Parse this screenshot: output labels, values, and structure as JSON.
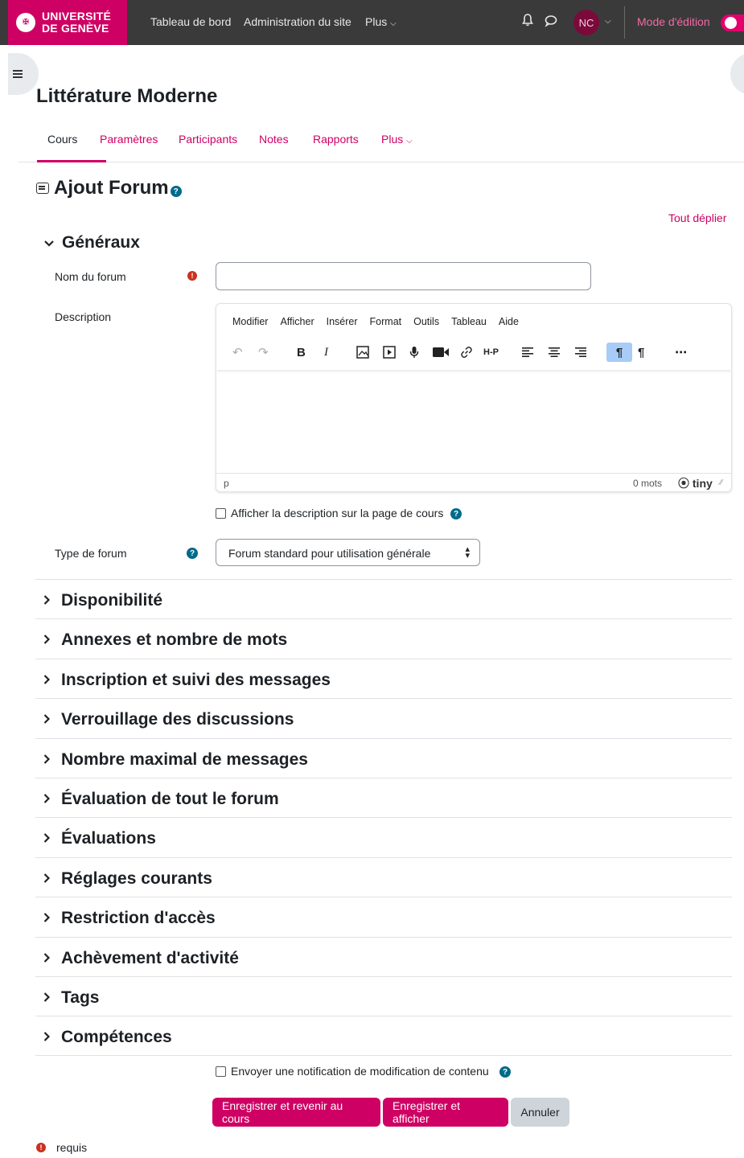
{
  "navbar": {
    "logo_line1": "UNIVERSITÉ",
    "logo_line2": "DE GENÈVE",
    "links": [
      "Tableau de bord",
      "Administration du site",
      "Plus"
    ],
    "avatar_initials": "NC",
    "edit_mode_label": "Mode d'édition"
  },
  "course": {
    "title": "Littérature Moderne",
    "tabs": [
      "Cours",
      "Paramètres",
      "Participants",
      "Notes",
      "Rapports",
      "Plus"
    ]
  },
  "page": {
    "heading": "Ajout Forum",
    "expand_all": "Tout déplier"
  },
  "general": {
    "title": "Généraux",
    "forum_name_label": "Nom du forum",
    "forum_name_value": "",
    "description_label": "Description",
    "editor": {
      "menus": [
        "Modifier",
        "Afficher",
        "Insérer",
        "Format",
        "Outils",
        "Tableau",
        "Aide"
      ],
      "path": "p",
      "word_count": "0 mots",
      "brand": "tiny"
    },
    "show_description_label": "Afficher la description sur la page de cours",
    "show_description_checked": false,
    "forum_type_label": "Type de forum",
    "forum_type_value": "Forum standard pour utilisation générale"
  },
  "sections": [
    "Disponibilité",
    "Annexes et nombre de mots",
    "Inscription et suivi des messages",
    "Verrouillage des discussions",
    "Nombre maximal de messages",
    "Évaluation de tout le forum",
    "Évaluations",
    "Réglages courants",
    "Restriction d'accès",
    "Achèvement d'activité",
    "Tags",
    "Compétences"
  ],
  "footer": {
    "notify_label": "Envoyer une notification de modification de contenu",
    "notify_checked": false,
    "save_return": "Enregistrer et revenir au cours",
    "save_display": "Enregistrer et afficher",
    "cancel": "Annuler",
    "required_note": "requis"
  },
  "colors": {
    "brand": "#cf0063",
    "navbar": "#3a3a3a",
    "help": "#006a8a",
    "required": "#ca3120"
  }
}
